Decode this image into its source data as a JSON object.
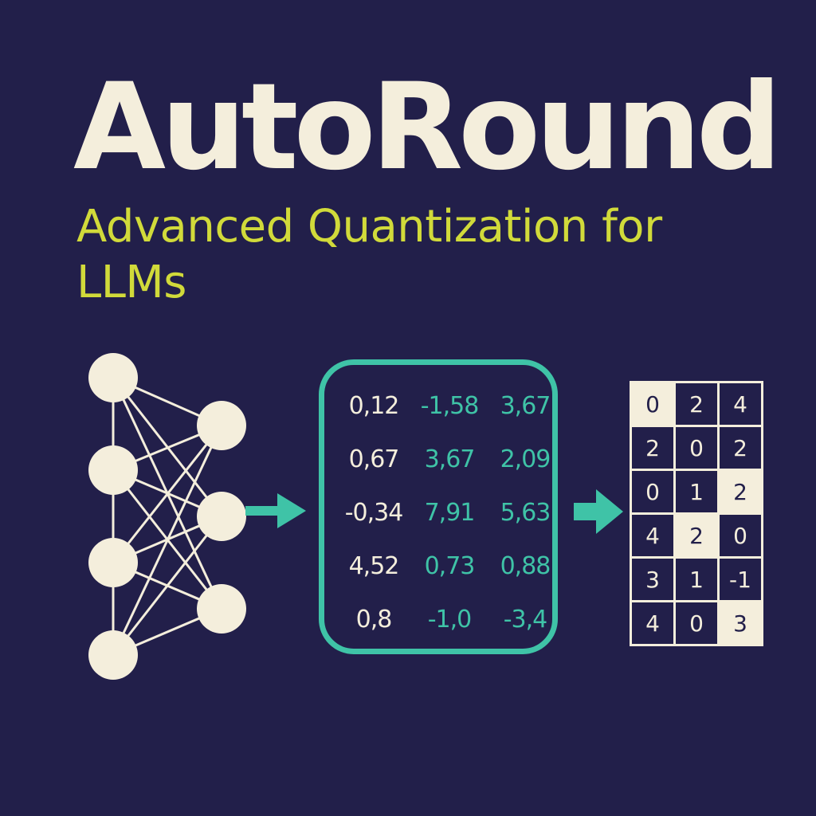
{
  "title": "AutoRound",
  "subtitle": "Advanced Quantization for LLMs",
  "colors": {
    "background": "#221f4a",
    "title": "#f4eedc",
    "subtitle": "#d1da3a",
    "accent": "#3fc3a7",
    "node": "#f4eedc"
  },
  "network": {
    "input_nodes": 4,
    "hidden_nodes": 3
  },
  "weights": [
    [
      "0,12",
      "-1,58",
      "3,67"
    ],
    [
      "0,67",
      "3,67",
      "2,09"
    ],
    [
      "-0,34",
      "7,91",
      "5,63"
    ],
    [
      "4,52",
      "0,73",
      "0,88"
    ],
    [
      "0,8",
      "-1,0",
      "-3,4"
    ]
  ],
  "quantized": [
    [
      {
        "v": "0",
        "hl": true
      },
      {
        "v": "2",
        "hl": false
      },
      {
        "v": "4",
        "hl": false
      }
    ],
    [
      {
        "v": "2",
        "hl": false
      },
      {
        "v": "0",
        "hl": false
      },
      {
        "v": "2",
        "hl": false
      }
    ],
    [
      {
        "v": "0",
        "hl": false
      },
      {
        "v": "1",
        "hl": false
      },
      {
        "v": "2",
        "hl": true
      }
    ],
    [
      {
        "v": "4",
        "hl": false
      },
      {
        "v": "2",
        "hl": true
      },
      {
        "v": "0",
        "hl": false
      }
    ],
    [
      {
        "v": "3",
        "hl": false
      },
      {
        "v": "1",
        "hl": false
      },
      {
        "v": "-1",
        "hl": false
      }
    ],
    [
      {
        "v": "4",
        "hl": false
      },
      {
        "v": "0",
        "hl": false
      },
      {
        "v": "3",
        "hl": true
      }
    ]
  ],
  "icons": {
    "arrow_1": "arrow-right-icon",
    "arrow_2": "arrow-right-icon",
    "network": "neural-network-icon"
  }
}
